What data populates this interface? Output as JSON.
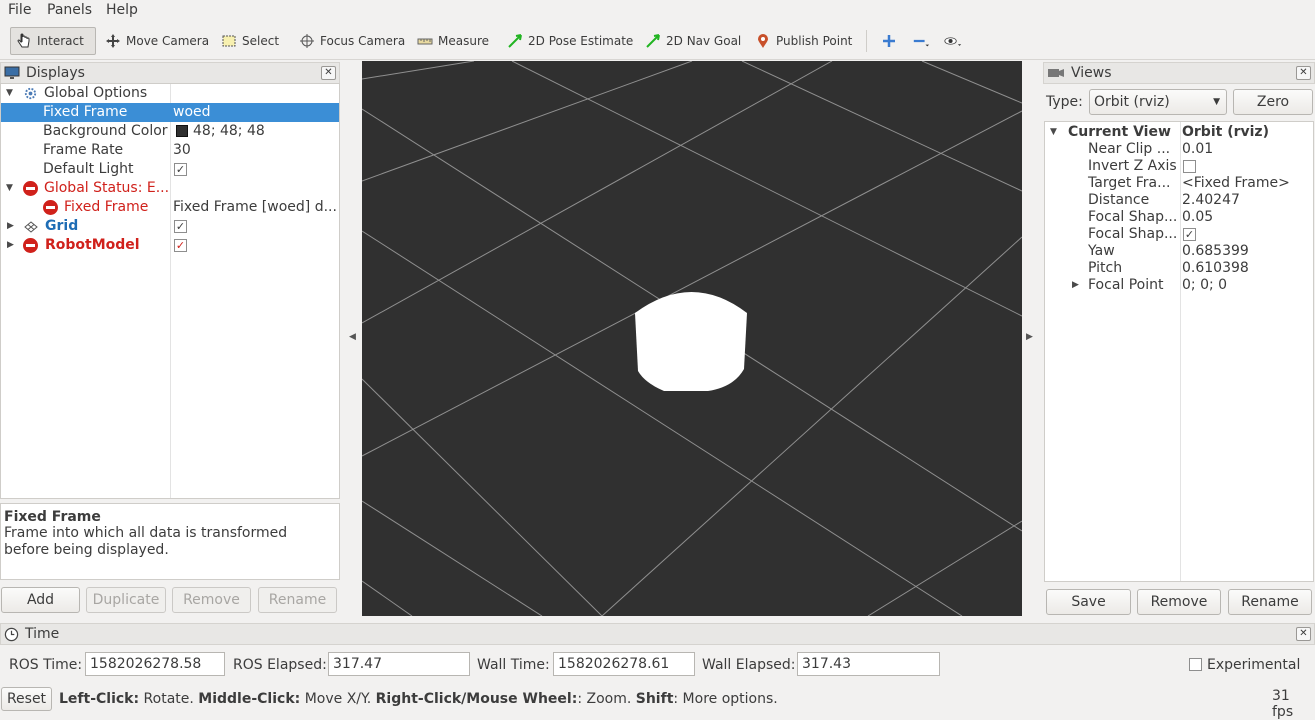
{
  "menu": [
    "File",
    "Panels",
    "Help"
  ],
  "toolbar": {
    "tools": [
      {
        "label": "Interact",
        "icon": "hand-pointer-icon"
      },
      {
        "label": "Move Camera",
        "icon": "move-arrows-icon"
      },
      {
        "label": "Select",
        "icon": "select-rect-icon"
      },
      {
        "label": "Focus Camera",
        "icon": "focus-target-icon"
      },
      {
        "label": "Measure",
        "icon": "ruler-icon"
      },
      {
        "label": "2D Pose Estimate",
        "icon": "pose-arrow-icon"
      },
      {
        "label": "2D Nav Goal",
        "icon": "nav-goal-arrow-icon"
      },
      {
        "label": "Publish Point",
        "icon": "map-pin-icon"
      }
    ]
  },
  "displays": {
    "title": "Displays",
    "rows": [
      {
        "name": "Global Options",
        "value": ""
      },
      {
        "name": "Fixed Frame",
        "value": "woed"
      },
      {
        "name": "Background Color",
        "value": "48; 48; 48"
      },
      {
        "name": "Frame Rate",
        "value": "30"
      },
      {
        "name": "Default Light",
        "value": ""
      },
      {
        "name": "Global Status: E...",
        "value": ""
      },
      {
        "name": "Fixed Frame",
        "value": "Fixed Frame [woed] d..."
      },
      {
        "name": "Grid",
        "value": ""
      },
      {
        "name": "RobotModel",
        "value": ""
      }
    ],
    "description_title": "Fixed Frame",
    "description_text": "Frame into which all data is transformed before being displayed.",
    "buttons": {
      "add": "Add",
      "duplicate": "Duplicate",
      "remove": "Remove",
      "rename": "Rename"
    }
  },
  "views": {
    "title": "Views",
    "type_label": "Type:",
    "type_value": "Orbit (rviz)",
    "zero_label": "Zero",
    "rows": [
      {
        "name": "Current View",
        "value": "Orbit (rviz)"
      },
      {
        "name": "Near Clip ...",
        "value": "0.01"
      },
      {
        "name": "Invert Z Axis",
        "value": ""
      },
      {
        "name": "Target Fra...",
        "value": "<Fixed Frame>"
      },
      {
        "name": "Distance",
        "value": "2.40247"
      },
      {
        "name": "Focal Shap...",
        "value": "0.05"
      },
      {
        "name": "Focal Shap...",
        "value": ""
      },
      {
        "name": "Yaw",
        "value": "0.685399"
      },
      {
        "name": "Pitch",
        "value": "0.610398"
      },
      {
        "name": "Focal Point",
        "value": "0; 0; 0"
      }
    ],
    "buttons": {
      "save": "Save",
      "remove": "Remove",
      "rename": "Rename"
    }
  },
  "time": {
    "title": "Time",
    "ros_time_label": "ROS Time:",
    "ros_time": "1582026278.58",
    "ros_elapsed_label": "ROS Elapsed:",
    "ros_elapsed": "317.47",
    "wall_time_label": "Wall Time:",
    "wall_time": "1582026278.61",
    "wall_elapsed_label": "Wall Elapsed:",
    "wall_elapsed": "317.43",
    "experimental_label": "Experimental"
  },
  "status": {
    "reset_label": "Reset",
    "hint_b1": "Left-Click:",
    "hint_t1": " Rotate. ",
    "hint_b2": "Middle-Click:",
    "hint_t2": " Move X/Y. ",
    "hint_b3": "Right-Click/Mouse Wheel:",
    "hint_t3": ": Zoom. ",
    "hint_b4": "Shift",
    "hint_t4": ": More options.",
    "fps": "31 fps"
  },
  "colors": {
    "viewport_bg": "#303030",
    "selection": "#4a90c8",
    "error": "#d0211b",
    "grid_link": "#1f6db5"
  }
}
